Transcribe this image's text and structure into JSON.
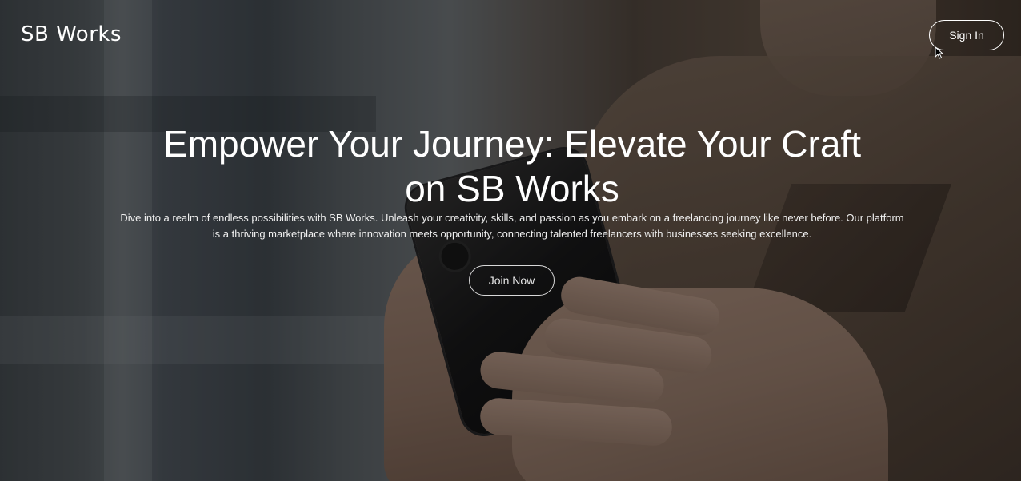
{
  "header": {
    "logo_text": "SB Works",
    "signin_label": "Sign In"
  },
  "hero": {
    "title": "Empower Your Journey: Elevate Your Craft on SB Works",
    "description": "Dive into a realm of endless possibilities with SB Works. Unleash your creativity, skills, and passion as you embark on a freelancing journey like never before. Our platform is a thriving marketplace where innovation meets opportunity, connecting talented freelancers with businesses seeking excellence.",
    "cta_label": "Join Now",
    "background_image": "person-holding-smartphone"
  },
  "icons": {
    "cursor": "mouse-pointer-icon"
  }
}
